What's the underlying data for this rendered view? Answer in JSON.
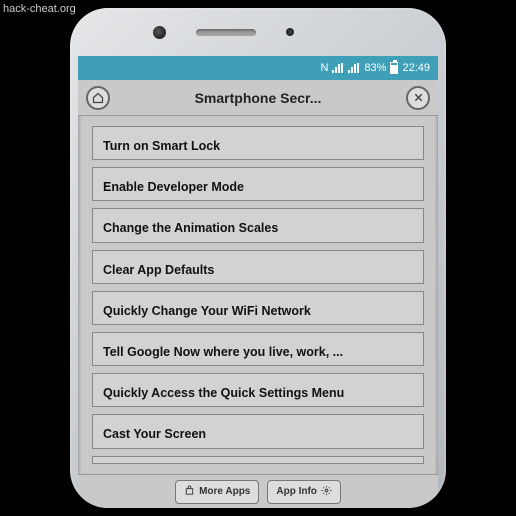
{
  "watermark": "hack-cheat.org",
  "status": {
    "nfc_icon": "N",
    "battery_pct": "83%",
    "time": "22:49"
  },
  "header": {
    "title": "Smartphone Secr..."
  },
  "list": {
    "items": [
      "Turn on Smart Lock",
      "Enable Developer Mode",
      "Change the Animation Scales",
      "Clear App Defaults",
      "Quickly Change Your WiFi Network",
      "Tell Google Now where you live, work, ...",
      "Quickly Access the Quick Settings Menu",
      "Cast Your Screen"
    ]
  },
  "bottom": {
    "more_apps": "More Apps",
    "app_info": "App Info"
  }
}
